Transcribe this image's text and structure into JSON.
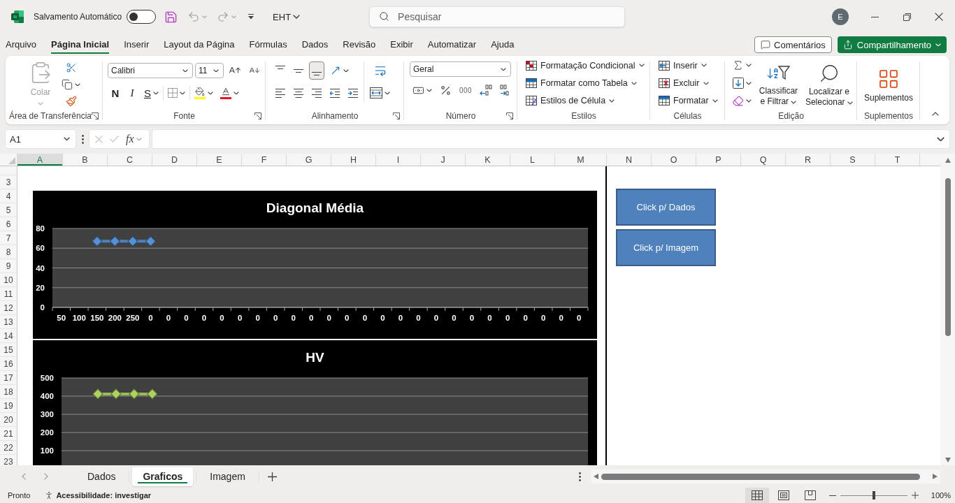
{
  "title_bar": {
    "autosave": {
      "label": "Salvamento Automático",
      "on": false
    },
    "document_name": "EHT",
    "search": {
      "placeholder": "Pesquisar"
    },
    "account_initial": "E"
  },
  "menu_tabs": [
    {
      "label": "Arquivo",
      "selected": false
    },
    {
      "label": "Página Inicial",
      "selected": true
    },
    {
      "label": "Inserir",
      "selected": false
    },
    {
      "label": "Layout da Página",
      "selected": false
    },
    {
      "label": "Fórmulas",
      "selected": false
    },
    {
      "label": "Dados",
      "selected": false
    },
    {
      "label": "Revisão",
      "selected": false
    },
    {
      "label": "Exibir",
      "selected": false
    },
    {
      "label": "Automatizar",
      "selected": false
    },
    {
      "label": "Ajuda",
      "selected": false
    }
  ],
  "comments_button": "Comentários",
  "share_button": "Compartilhamento",
  "ribbon": {
    "clipboard": {
      "label": "Área de Transferência",
      "paste": {
        "label": "Colar",
        "disabled": true
      }
    },
    "font": {
      "label": "Fonte",
      "font_name": "Calibri",
      "font_size": "11",
      "style_buttons": [
        {
          "label": "N",
          "kind": "bold"
        },
        {
          "label": "I",
          "kind": "italic"
        },
        {
          "label": "S",
          "kind": "underline"
        }
      ]
    },
    "alignment": {
      "label": "Alinhamento",
      "vertical_align": [
        {
          "selected": false
        },
        {
          "selected": false
        },
        {
          "selected": true
        }
      ]
    },
    "number": {
      "label": "Número",
      "format": "Geral",
      "thousands_button": "000"
    },
    "styles": {
      "label": "Estilos",
      "commands": [
        "Formatação Condicional",
        "Formatar como Tabela",
        "Estilos de Célula"
      ]
    },
    "cells": {
      "label": "Células",
      "commands": [
        "Inserir",
        "Excluir",
        "Formatar"
      ]
    },
    "editing": {
      "label": "Edição",
      "sort_filter": "Classificar e Filtrar",
      "find_select": "Localizar e Selecionar"
    },
    "addins": {
      "label": "Suplementos",
      "button": "Suplementos"
    }
  },
  "formula_bar": {
    "name_box": "A1",
    "function_label": "fx"
  },
  "sheet": {
    "columns": [
      {
        "label": "A",
        "selected": true
      },
      {
        "label": "B",
        "selected": false
      },
      {
        "label": "C",
        "selected": false
      },
      {
        "label": "D",
        "selected": false
      },
      {
        "label": "E",
        "selected": false
      },
      {
        "label": "F",
        "selected": false
      },
      {
        "label": "G",
        "selected": false
      },
      {
        "label": "H",
        "selected": false
      },
      {
        "label": "I",
        "selected": false
      },
      {
        "label": "J",
        "selected": false
      },
      {
        "label": "K",
        "selected": false
      },
      {
        "label": "L",
        "selected": false
      },
      {
        "label": "M",
        "selected": false
      },
      {
        "label": "N",
        "selected": false
      },
      {
        "label": "O",
        "selected": false
      },
      {
        "label": "P",
        "selected": false
      },
      {
        "label": "Q",
        "selected": false
      },
      {
        "label": "R",
        "selected": false
      },
      {
        "label": "S",
        "selected": false
      },
      {
        "label": "T",
        "selected": false
      }
    ],
    "rows": [
      "3",
      "4",
      "5",
      "6",
      "7",
      "8",
      "9",
      "10",
      "11",
      "12",
      "13",
      "14",
      "15",
      "16",
      "17",
      "18",
      "19",
      "20",
      "21",
      "22",
      "23"
    ],
    "charts": [
      {
        "chart_data": {
          "type": "line",
          "title": "Diagonal Média",
          "categories": [
            "50",
            "100",
            "150",
            "200",
            "250",
            "0",
            "0",
            "0",
            "0",
            "0",
            "0",
            "0",
            "0",
            "0",
            "0",
            "0",
            "0",
            "0",
            "0",
            "0",
            "0",
            "0",
            "0",
            "0",
            "0",
            "0",
            "0",
            "0",
            "0",
            "0"
          ],
          "series": [
            {
              "color": "#4f81bd",
              "marker": "diamond",
              "values": [
                null,
                null,
                67,
                67,
                67,
                67,
                null,
                null,
                null,
                null,
                null,
                null,
                null,
                null,
                null,
                null,
                null,
                null,
                null,
                null,
                null,
                null,
                null,
                null,
                null,
                null,
                null,
                null,
                null,
                null
              ]
            }
          ],
          "ylim": [
            0,
            80
          ],
          "yticks": [
            0,
            20,
            40,
            60,
            80
          ],
          "grid": true
        }
      },
      {
        "chart_data": {
          "type": "line",
          "title": "HV",
          "series": [
            {
              "color": "#9bbb59",
              "marker": "diamond",
              "values": [
                null,
                null,
                412,
                412,
                412,
                412,
                null,
                null,
                null,
                null,
                null,
                null,
                null,
                null,
                null,
                null,
                null,
                null,
                null,
                null,
                null,
                null,
                null,
                null,
                null,
                null,
                null,
                null,
                null,
                null
              ]
            }
          ],
          "ylim": [
            20,
            500
          ],
          "yticks": [
            100,
            200,
            300,
            400,
            500
          ],
          "grid": true
        }
      }
    ],
    "buttons": [
      "Click p/ Dados",
      "Click p/ Imagem"
    ]
  },
  "sheet_tabs": [
    {
      "label": "Dados",
      "selected": false
    },
    {
      "label": "Graficos",
      "selected": true
    },
    {
      "label": "Imagem",
      "selected": false
    }
  ],
  "status_bar": {
    "status": "Pronto",
    "accessibility": "Acessibilidade: investigar",
    "views": [
      {
        "selected": true
      },
      {
        "selected": false
      },
      {
        "selected": false
      }
    ],
    "zoom": {
      "level": 0.5,
      "reading": "100%"
    }
  }
}
